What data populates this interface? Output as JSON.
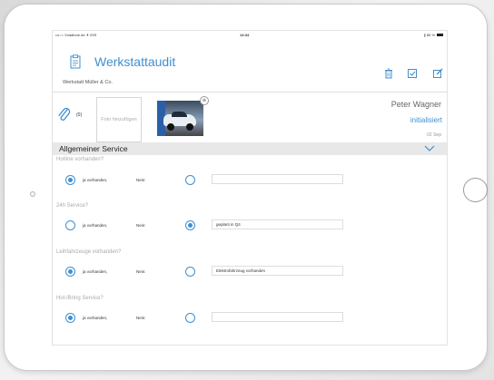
{
  "status_bar": {
    "carrier": "•••○○ Vodafone.de ✈ 09S",
    "time": "14:34",
    "battery": "∦ 86 %"
  },
  "header": {
    "app_icon": "clipboard-icon",
    "title": "Werkstattaudit",
    "subtitle": "Werkstatt Müller & Co.",
    "actions": [
      {
        "icon": "trash-icon"
      },
      {
        "icon": "checkbox-icon"
      },
      {
        "icon": "edit-icon"
      }
    ]
  },
  "attachments": {
    "icon": "paperclip-icon",
    "count": "(0)",
    "add_photo_label": "Foto hinzufügen",
    "photo_badge": "⊗"
  },
  "meta": {
    "person": "Peter Wagner",
    "status": "initialisiert",
    "date": "02 Sep"
  },
  "section": {
    "title": "Allgemeiner Service",
    "chevron": "chevron-down-icon"
  },
  "questions": [
    {
      "label": "Hotline vorhanden?",
      "yes_label": "ja vorhanden,",
      "no_label": "Nein:",
      "selected": "yes",
      "comment": ""
    },
    {
      "label": "24h Service?",
      "yes_label": "ja vorhanden,",
      "no_label": "Nein:",
      "selected": "no",
      "comment": "geplant in Q4"
    },
    {
      "label": "Leihfahrzeuge vorhanden?",
      "yes_label": "ja vorhanden,",
      "no_label": "Nein:",
      "selected": "yes",
      "comment": "Elektrofahrzeug vorhanden"
    },
    {
      "label": "Hol-/Bring Service?",
      "yes_label": "ja vorhanden,",
      "no_label": "Nein:",
      "selected": "yes",
      "comment": ""
    }
  ],
  "colors": {
    "accent": "#3f8fd1",
    "section_bg": "#e8e8e8"
  }
}
